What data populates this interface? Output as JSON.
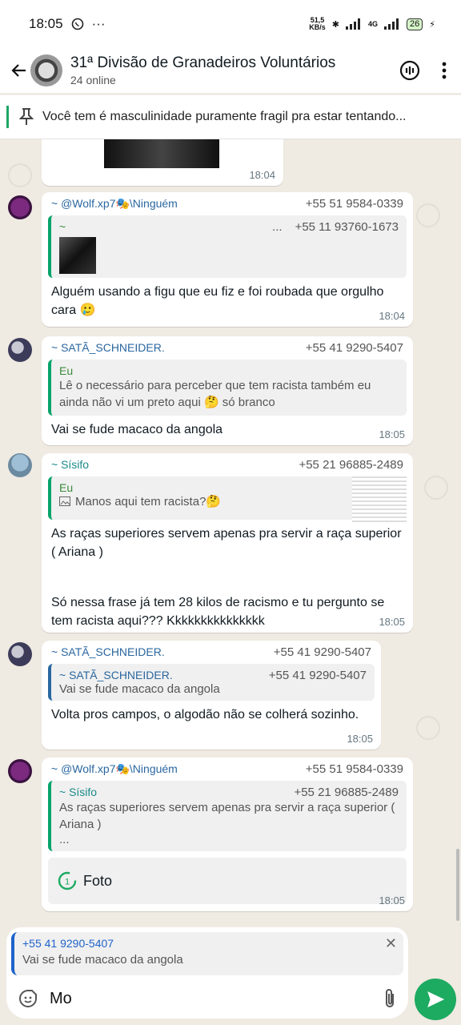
{
  "status": {
    "time": "18:05",
    "net": "51,5\nKB/s",
    "signal": "4G",
    "battery": "26"
  },
  "header": {
    "title": "31ª Divisão de Granadeiros Voluntários",
    "subtitle": "24 online"
  },
  "pinned": {
    "text": "Você tem é masculinidade puramente fragil pra estar tentando..."
  },
  "messages": [
    {
      "time": "18:04"
    },
    {
      "sender": "~ @Wolf.xp7🎭\\Ninguém",
      "phone": "+55 51 9584-0339",
      "quote_name": "~",
      "quote_dots": "...",
      "quote_phone": "+55 11 93760-1673",
      "text": "Alguém usando a figu que eu fiz e foi roubada que orgulho cara 🥲",
      "time": "18:04"
    },
    {
      "sender": "~ SATÃ_SCHNEIDER.",
      "phone": "+55 41 9290-5407",
      "quote_name": "Eu",
      "quote_text": "Lê o necessário para perceber que tem racista também eu ainda não vi um preto aqui 🤔 só branco",
      "text": "Vai se fude macaco da angola",
      "time": "18:05"
    },
    {
      "sender": "~ Sísifo",
      "phone": "+55 21 96885-2489",
      "quote_name": "Eu",
      "quote_text": "Manos aqui tem racista?🤔",
      "text1": "As raças superiores servem apenas pra servir a raça superior ( Ariana )",
      "text2": "Só nessa frase já tem 28 kilos de racismo e tu pergunto se tem racista aqui??? Kkkkkkkkkkkkkkk",
      "time": "18:05"
    },
    {
      "sender": "~ SATÃ_SCHNEIDER.",
      "phone": "+55 41 9290-5407",
      "quote_name": "~ SATÃ_SCHNEIDER.",
      "quote_phone": "+55 41 9290-5407",
      "quote_text": "Vai se fude macaco da angola",
      "text": "Volta pros campos, o algodão não se colherá sozinho.",
      "time": "18:05"
    },
    {
      "sender": "~ @Wolf.xp7🎭\\Ninguém",
      "phone": "+55 51 9584-0339",
      "quote_name": "~ Sísifo",
      "quote_phone": "+55 21 96885-2489",
      "quote_text": "As raças superiores servem apenas pra servir a raça superior ( Ariana )",
      "quote_more": "...",
      "photo_label": "Foto",
      "time": "18:05"
    }
  ],
  "composer": {
    "reply_phone": "+55 41 9290-5407",
    "reply_text": "Vai se fude macaco da angola",
    "typed": "Mo"
  },
  "colors": {
    "accent": "#1daa61",
    "quote_bar": "#06a36a",
    "reply_bar": "#1f63c9"
  }
}
